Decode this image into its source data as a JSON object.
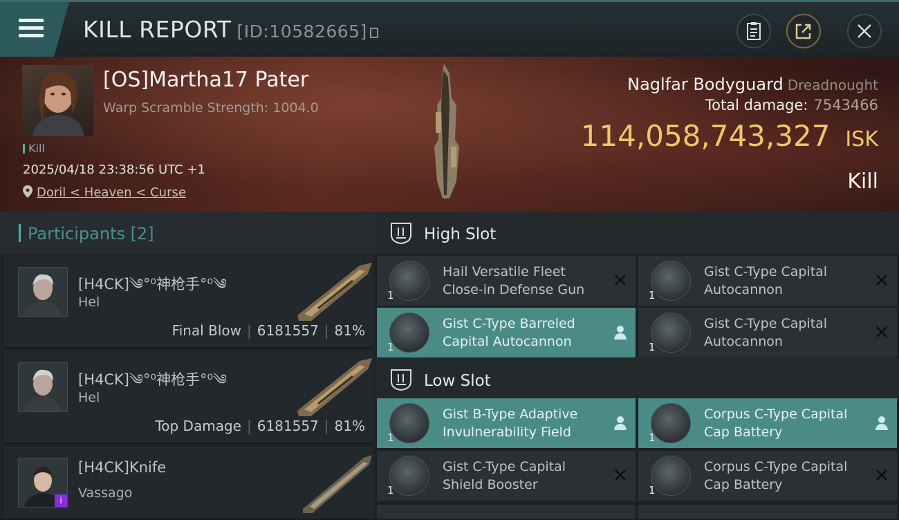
{
  "header": {
    "title": "KILL REPORT",
    "report_id": "[ID:10582665]"
  },
  "victim": {
    "name": "[OS]Martha17 Pater",
    "warp_scramble": "Warp Scramble Strength: 1004.0",
    "tag": "Kill",
    "datetime": "2025/04/18 23:38:56 UTC +1",
    "location": "Doril < Heaven < Curse",
    "ship_name": "Naglfar Bodyguard",
    "ship_class": "Dreadnought",
    "total_damage_label": "Total damage:",
    "total_damage": "7543466",
    "isk_value": "114,058,743,327",
    "isk_unit": "ISK",
    "result": "Kill"
  },
  "participants": {
    "title": "Participants",
    "count": "[2]",
    "rows": [
      {
        "name": "[H4CK]༄°⁰神枪手°⁰༄",
        "ship": "Hel",
        "role": "Final Blow",
        "damage": "6181557",
        "percent": "81%"
      },
      {
        "name": "[H4CK]༄°⁰神枪手°⁰༄",
        "ship": "Hel",
        "role": "Top Damage",
        "damage": "6181557",
        "percent": "81%"
      },
      {
        "name": "[H4CK]Knife",
        "ship": "Vassago",
        "badge": "i"
      }
    ]
  },
  "slots": {
    "high": {
      "title": "High Slot",
      "items": [
        {
          "name": "Hail Versatile Fleet Close-in Defense Gun",
          "qty": "1",
          "state": "destroyed"
        },
        {
          "name": "Gist C-Type Capital Autocannon",
          "qty": "1",
          "state": "destroyed"
        },
        {
          "name": "Gist C-Type Barreled Capital Autocannon",
          "qty": "1",
          "state": "dropped"
        },
        {
          "name": "Gist C-Type Capital Autocannon",
          "qty": "1",
          "state": "destroyed"
        }
      ]
    },
    "low": {
      "title": "Low Slot",
      "items": [
        {
          "name": "Gist B-Type Adaptive Invulnerability Field",
          "qty": "1",
          "state": "dropped"
        },
        {
          "name": "Corpus C-Type Capital Cap Battery",
          "qty": "1",
          "state": "dropped"
        },
        {
          "name": "Gist C-Type Capital Shield Booster",
          "qty": "1",
          "state": "destroyed"
        },
        {
          "name": "Corpus C-Type Capital Cap Battery",
          "qty": "1",
          "state": "destroyed"
        }
      ]
    }
  },
  "colors": {
    "accent": "#4fb0a5",
    "selected_item": "#4a8c85",
    "isk": "#f1c66b"
  }
}
